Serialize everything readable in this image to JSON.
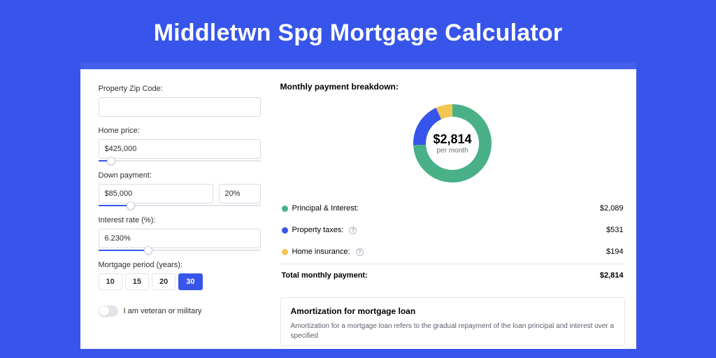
{
  "page_title": "Middletwn Spg Mortgage Calculator",
  "form": {
    "zip_label": "Property Zip Code:",
    "zip_value": "",
    "home_price_label": "Home price:",
    "home_price_value": "$425,000",
    "home_price_slider_pct": 8,
    "down_payment_label": "Down payment:",
    "down_payment_value": "$85,000",
    "down_payment_pct_value": "20%",
    "down_payment_slider_pct": 20,
    "interest_label": "Interest rate (%):",
    "interest_value": "6.230%",
    "interest_slider_pct": 31,
    "period_label": "Mortgage period (years):",
    "periods": [
      "10",
      "15",
      "20",
      "30"
    ],
    "period_active": "30",
    "vet_toggle_label": "I am veteran or military",
    "vet_toggle_on": false
  },
  "breakdown": {
    "title": "Monthly payment breakdown:",
    "center_value": "$2,814",
    "center_sub": "per month",
    "rows": [
      {
        "label": "Principal & Interest:",
        "amount": "$2,089",
        "color": "green",
        "info": false
      },
      {
        "label": "Property taxes:",
        "amount": "$531",
        "color": "blue",
        "info": true
      },
      {
        "label": "Home insurance:",
        "amount": "$194",
        "color": "yellow",
        "info": true
      }
    ],
    "total_label": "Total monthly payment:",
    "total_amount": "$2,814"
  },
  "amort": {
    "heading": "Amortization for mortgage loan",
    "body": "Amortization for a mortgage loan refers to the gradual repayment of the loan principal and interest over a specified"
  },
  "chart_data": {
    "type": "pie",
    "title": "Monthly payment breakdown",
    "series": [
      {
        "name": "Principal & Interest",
        "value": 2089,
        "color": "#49b088"
      },
      {
        "name": "Property taxes",
        "value": 531,
        "color": "#3755ea"
      },
      {
        "name": "Home insurance",
        "value": 194,
        "color": "#f1c651"
      }
    ],
    "center_label": "$2,814 per month",
    "total": 2814
  }
}
